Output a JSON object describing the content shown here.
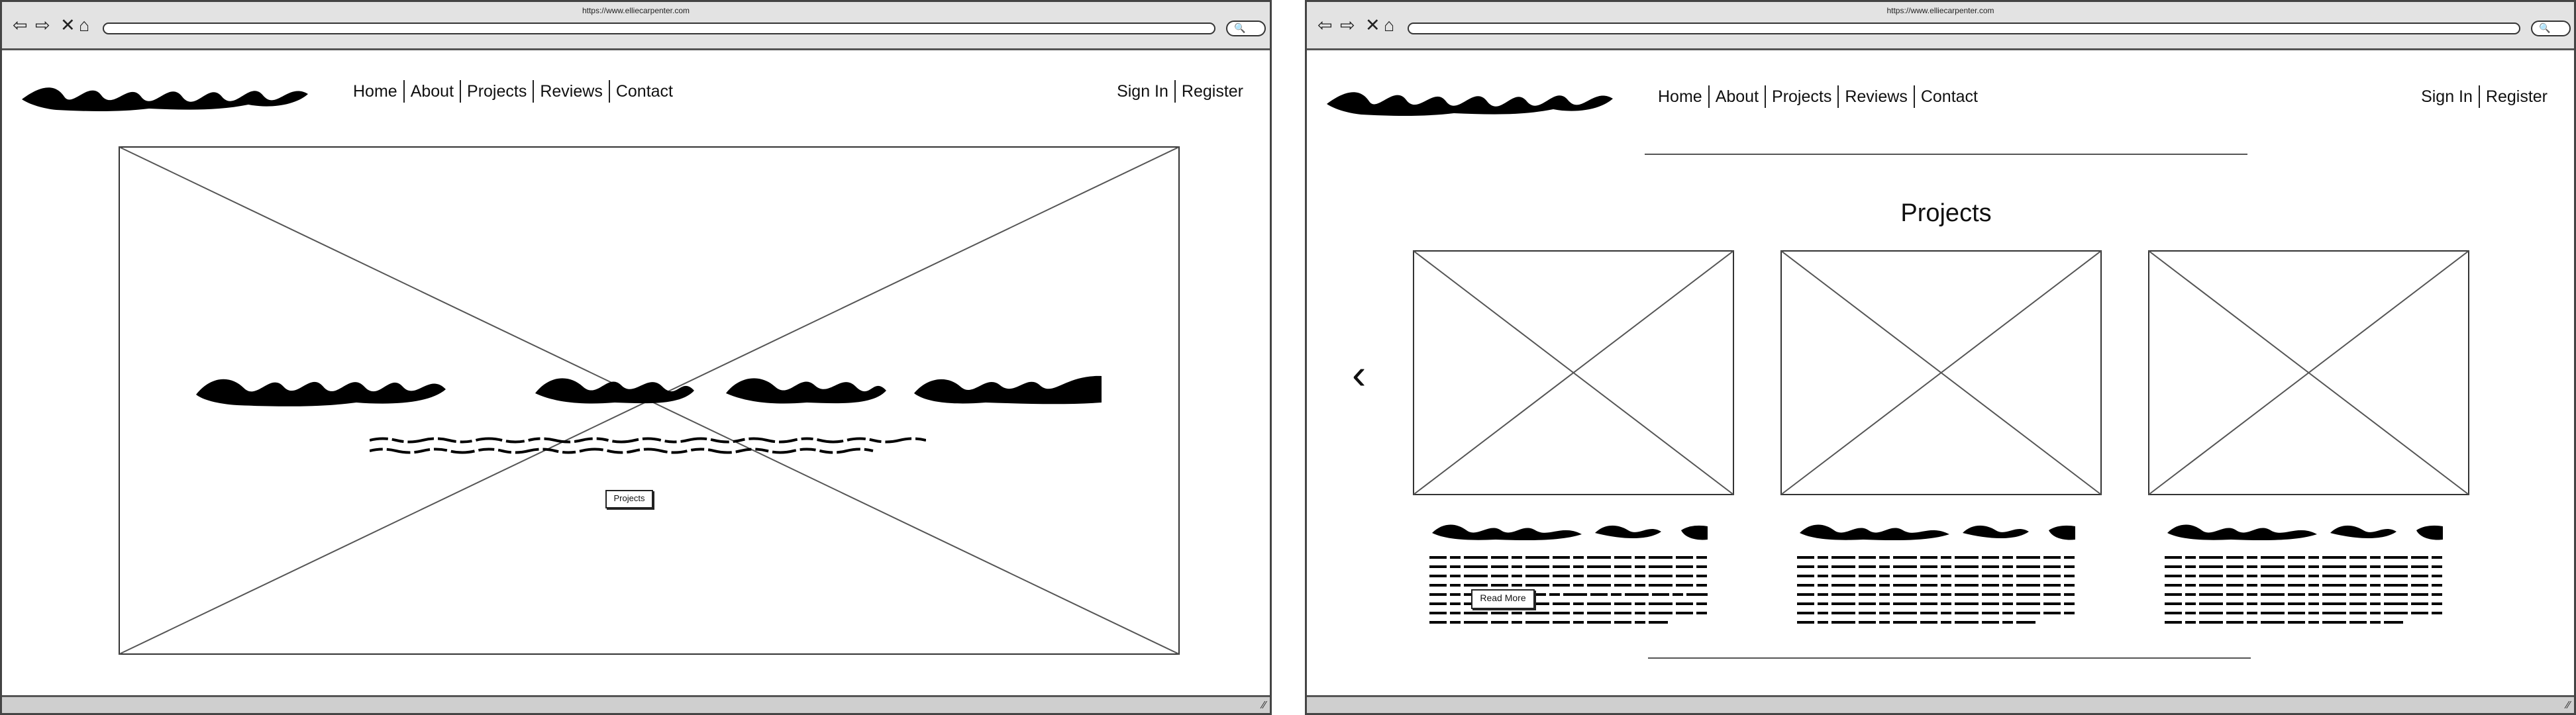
{
  "browser": {
    "url": "https://www.elliecarpenter.com",
    "nav_icons": [
      "back-arrow-icon",
      "forward-arrow-icon",
      "close-icon",
      "home-icon"
    ],
    "search_icon": "search-icon"
  },
  "header": {
    "logo_icon": "scribble-logo-icon",
    "nav": [
      {
        "label": "Home"
      },
      {
        "label": "About"
      },
      {
        "label": "Projects"
      },
      {
        "label": "Reviews"
      },
      {
        "label": "Contact"
      }
    ],
    "sign_in": "Sign In",
    "register": "Register"
  },
  "hero": {
    "image_icon": "image-placeholder-icon",
    "headline_icon": "scribble-headline-icon",
    "text_icon": "scribble-text-icon",
    "button_label": "Projects"
  },
  "projects_section": {
    "title": "Projects",
    "prev_icon": "chevron-left-icon",
    "cards": [
      {
        "image_icon": "image-placeholder-icon",
        "title_icon": "scribble-title-icon",
        "text_icon": "scribble-text-icon",
        "button_label": "Read More"
      },
      {
        "image_icon": "image-placeholder-icon",
        "title_icon": "scribble-title-icon",
        "text_icon": "scribble-text-icon"
      },
      {
        "image_icon": "image-placeholder-icon",
        "title_icon": "scribble-title-icon",
        "text_icon": "scribble-text-icon"
      }
    ]
  },
  "colors": {
    "chrome": "#e3e3e3",
    "border": "#444444",
    "ink": "#111111"
  }
}
